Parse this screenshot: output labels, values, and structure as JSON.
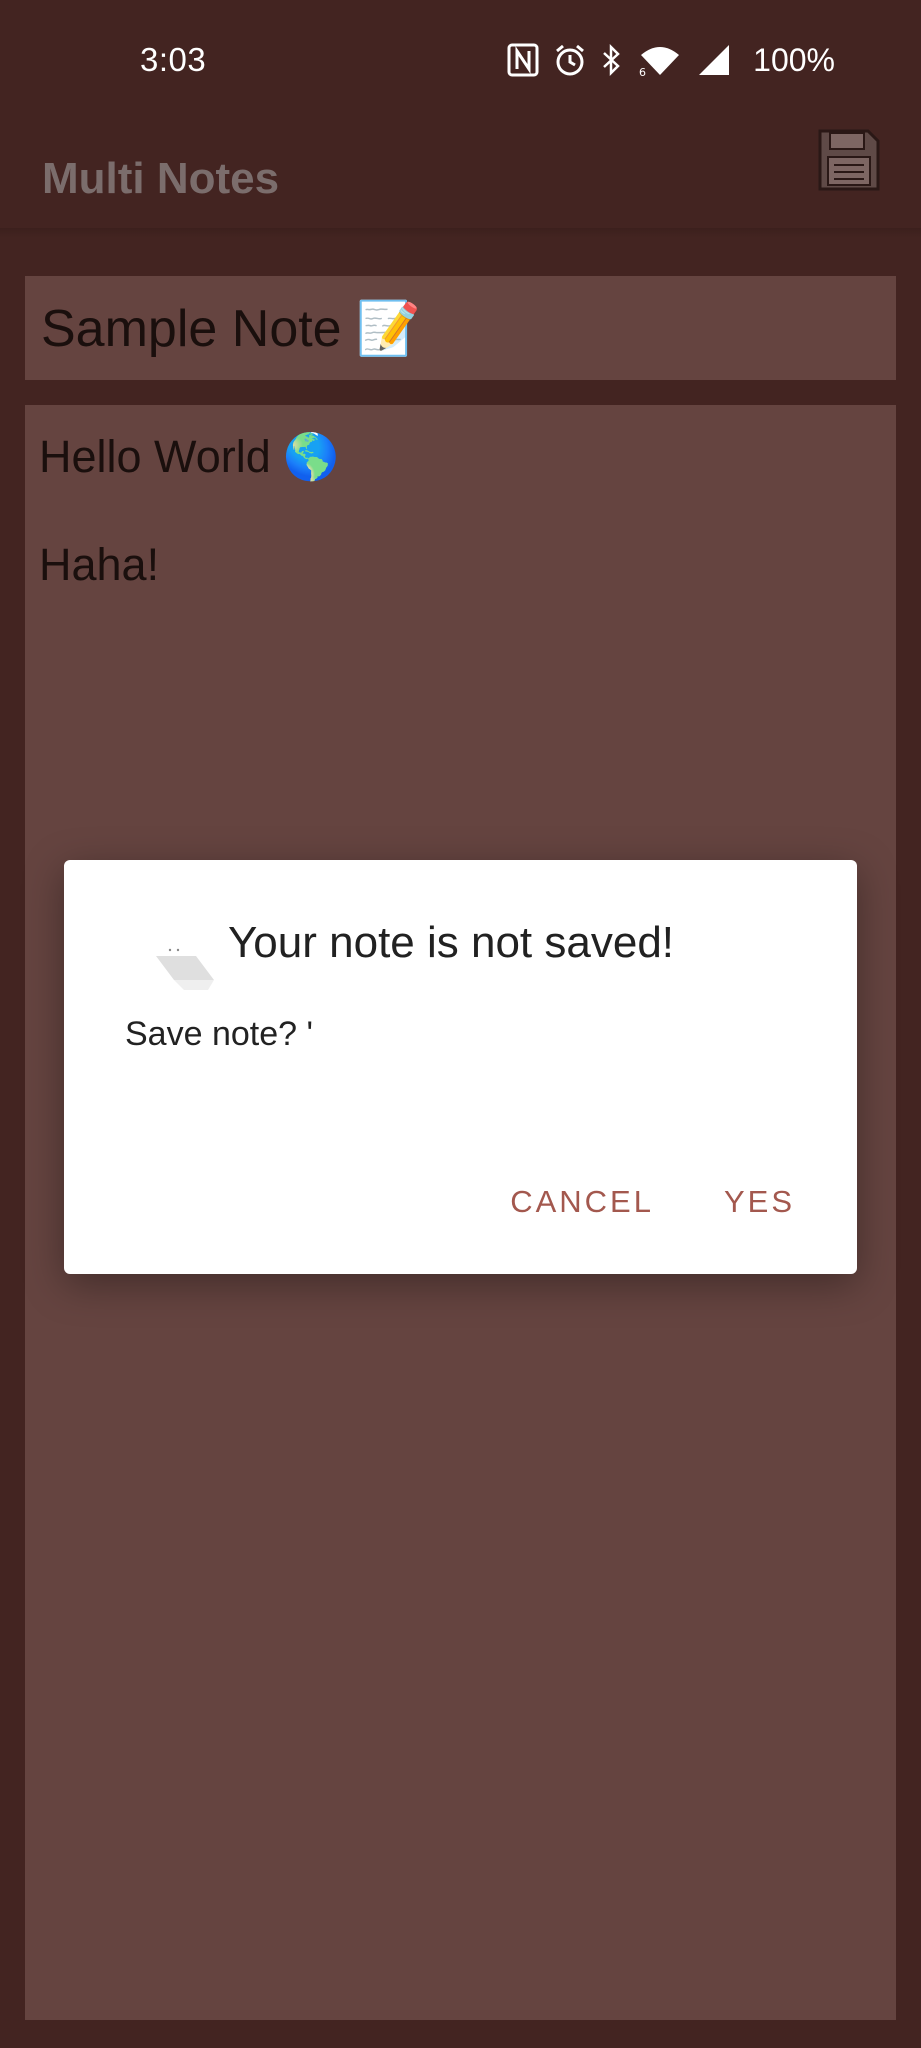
{
  "status_bar": {
    "time": "3:03",
    "battery": "100%",
    "icons": [
      "nfc-icon",
      "alarm-icon",
      "bluetooth-icon",
      "wifi-icon",
      "signal-icon"
    ]
  },
  "app_bar": {
    "title": "Multi Notes",
    "save_icon": "save-icon"
  },
  "note": {
    "title": "Sample Note 📝",
    "body_lines": [
      "Hello World 🌎",
      "Haha!"
    ]
  },
  "dialog": {
    "title": "Your note is not saved!",
    "message": "Save note? '",
    "cancel_label": "CANCEL",
    "yes_label": "YES"
  },
  "colors": {
    "background": "#432421",
    "field": "#654440",
    "accent": "#A3584E",
    "dialog": "#FFFFFF"
  }
}
